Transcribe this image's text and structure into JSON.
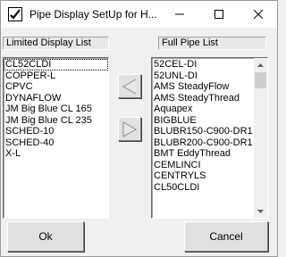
{
  "window": {
    "title": "Pipe Display SetUp for H...",
    "controls": {
      "minimize": "minimize",
      "maximize": "maximize",
      "close": "close"
    }
  },
  "limited_list": {
    "caption": "Limited Display List",
    "items": [
      "CL52CLDI",
      "COPPER-L",
      "CPVC",
      "DYNAFLOW",
      "JM Big Blue CL 165",
      "JM Big Blue CL 235",
      "SCHED-10",
      "SCHED-40",
      "X-L"
    ],
    "focused_index": 0
  },
  "full_list": {
    "caption": "Full Pipe List",
    "items": [
      "52CEL-DI",
      "52UNL-DI",
      "AMS SteadyFlow",
      "AMS SteadyThread",
      "Aquapex",
      "BIGBLUE",
      "BLUBR150-C900-DR1",
      "BLUBR200-C900-DR1",
      "BMT EddyThread",
      "CEMLINCI",
      "CENTRYLS",
      "CL50CLDI"
    ]
  },
  "buttons": {
    "move_left": "arrow-left-icon",
    "move_right": "arrow-right-icon",
    "ok": "Ok",
    "cancel": "Cancel"
  },
  "colors": {
    "window_bg": "#f0f0f0",
    "list_bg": "#ffffff",
    "button_bg": "#e1e1e1"
  }
}
